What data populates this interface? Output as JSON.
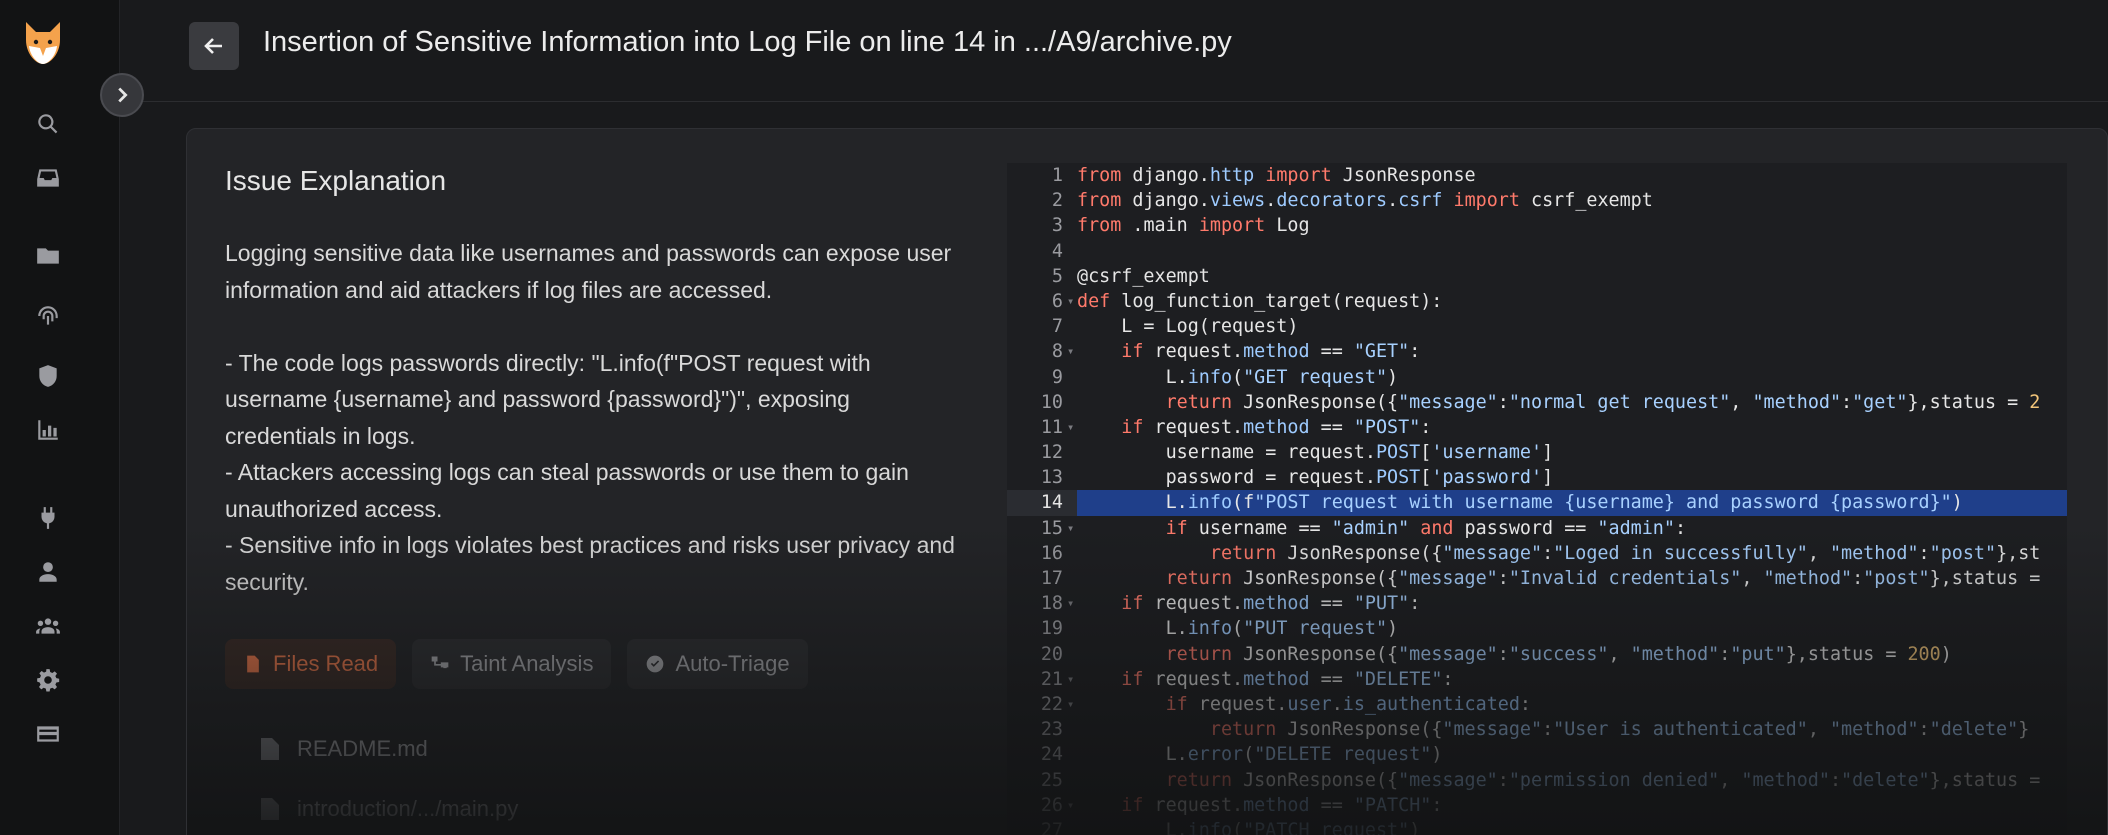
{
  "header": {
    "back_label": "Back",
    "title": "Insertion of Sensitive Information into Log File on line 14 in .../A9/archive.py"
  },
  "sidebar": {
    "icons": [
      "search-icon",
      "inbox-icon",
      "folder-icon",
      "fingerprint-icon",
      "shield-icon",
      "chart-icon",
      "plug-icon",
      "user-icon",
      "users-icon",
      "gear-icon",
      "billing-icon"
    ]
  },
  "issue": {
    "heading": "Issue Explanation",
    "paragraphs": [
      "Logging sensitive data like usernames and passwords can expose user information and aid attackers if log files are accessed.",
      "- The code logs passwords directly: \"L.info(f\"POST request with username {username} and password {password}\")\", exposing credentials in logs.",
      "- Attackers accessing logs can steal passwords or use them to gain unauthorized access.",
      "- Sensitive info in logs violates best practices and risks user privacy and security."
    ]
  },
  "tabs": [
    {
      "label": "Files Read",
      "active": true
    },
    {
      "label": "Taint Analysis",
      "active": false
    },
    {
      "label": "Auto-Triage",
      "active": false
    }
  ],
  "files": [
    "README.md",
    "introduction/.../main.py"
  ],
  "code": {
    "highlight_line": 14,
    "lines": [
      "from django.http import JsonResponse",
      "from django.views.decorators.csrf import csrf_exempt",
      "from .main import Log",
      "",
      "@csrf_exempt",
      "def log_function_target(request):",
      "    L = Log(request)",
      "    if request.method == \"GET\":",
      "        L.info(\"GET request\")",
      "        return JsonResponse({\"message\":\"normal get request\", \"method\":\"get\"},status = 2",
      "    if request.method == \"POST\":",
      "        username = request.POST['username']",
      "        password = request.POST['password']",
      "        L.info(f\"POST request with username {username} and password {password}\")",
      "        if username == \"admin\" and password == \"admin\":",
      "            return JsonResponse({\"message\":\"Loged in successfully\", \"method\":\"post\"},st",
      "        return JsonResponse({\"message\":\"Invalid credentials\", \"method\":\"post\"},status =",
      "    if request.method == \"PUT\":",
      "        L.info(\"PUT request\")",
      "        return JsonResponse({\"message\":\"success\", \"method\":\"put\"},status = 200)",
      "    if request.method == \"DELETE\":",
      "        if request.user.is_authenticated:",
      "            return JsonResponse({\"message\":\"User is authenticated\", \"method\":\"delete\"}",
      "        L.error(\"DELETE request\")",
      "        return JsonResponse({\"message\":\"permission denied\", \"method\":\"delete\"},status =",
      "    if request.method == \"PATCH\":",
      "        L.info(\"PATCH request\")"
    ],
    "fold_lines": [
      6,
      8,
      11,
      15,
      18,
      21,
      22,
      26
    ]
  },
  "colors": {
    "accent": "#e8764a",
    "keyword": "#ff7a6b",
    "string": "#a8d1ff",
    "number": "#f2c57a",
    "highlight": "#1f3f8a"
  }
}
